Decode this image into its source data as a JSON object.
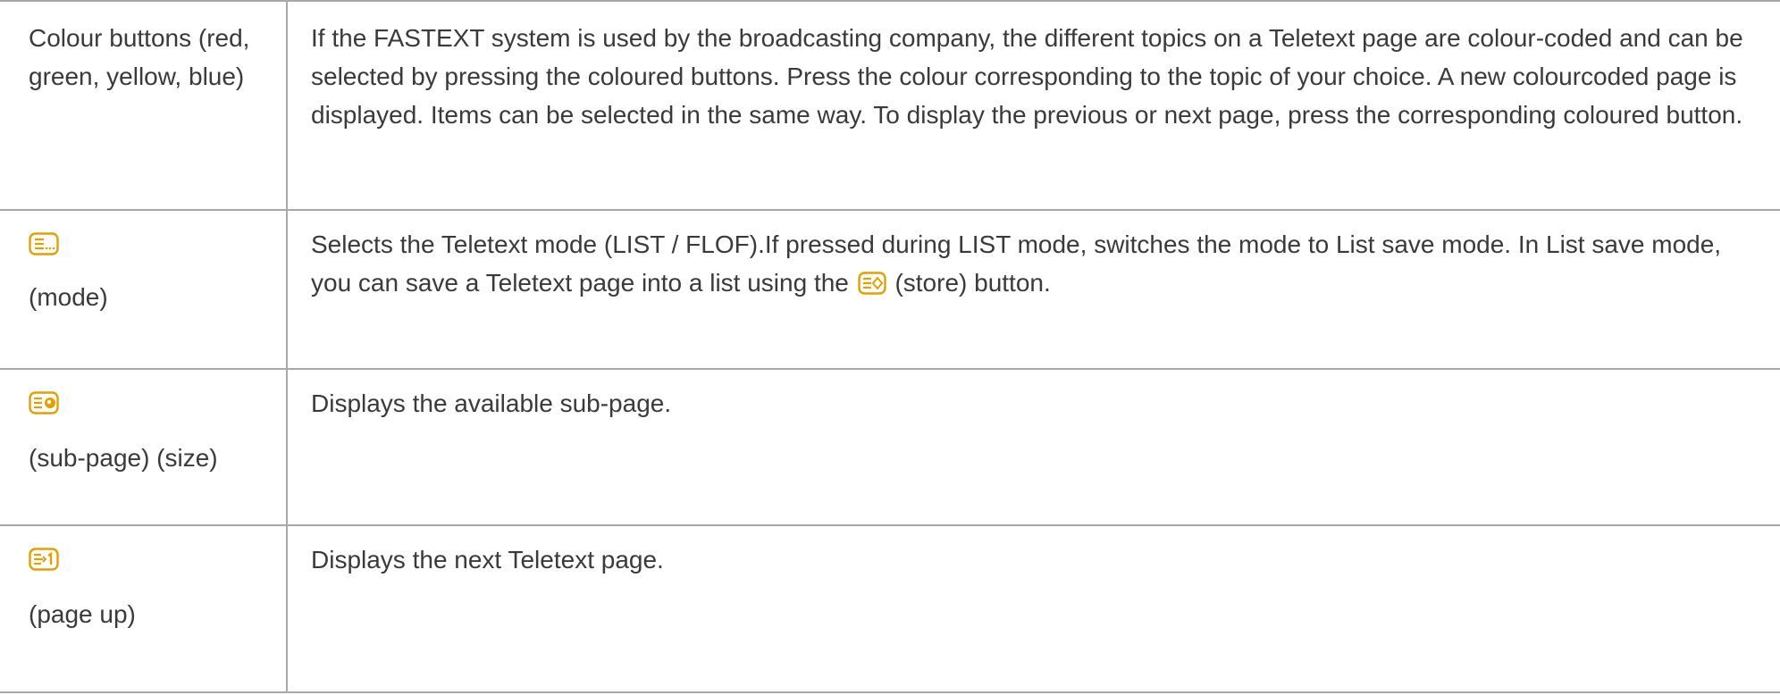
{
  "rows": [
    {
      "key_lines": [
        "Colour buttons (red,",
        "green, yellow, blue)"
      ],
      "description": "If the FASTEXT system is used by the broadcasting company, the different topics on a Teletext page are colour-coded and can be selected by pressing the coloured buttons. Press the colour corresponding to the topic of your choice. A new colourcoded page is displayed. Items can be selected in the same way. To display the previous or next page, press the corresponding coloured button."
    },
    {
      "key_icon": "teletext-mode-icon",
      "key_label": "(mode)",
      "description_before": "Selects the Teletext mode (LIST / FLOF).If pressed during LIST mode, switches the mode to List save mode. In List save mode, you can save a Teletext page into a list using the",
      "description_icon": "teletext-store-icon",
      "description_after": "(store) button."
    },
    {
      "key_icon": "teletext-subpage-icon",
      "key_label": "(sub-page) (size)",
      "description": "Displays the available sub-page."
    },
    {
      "key_icon": "teletext-page-up-icon",
      "key_label": "(page up)",
      "description": "Displays the next Teletext page."
    }
  ],
  "colors": {
    "icon_accent": "#e3a000",
    "rule": "#a8a8a8",
    "text": "#3a3a3a"
  }
}
